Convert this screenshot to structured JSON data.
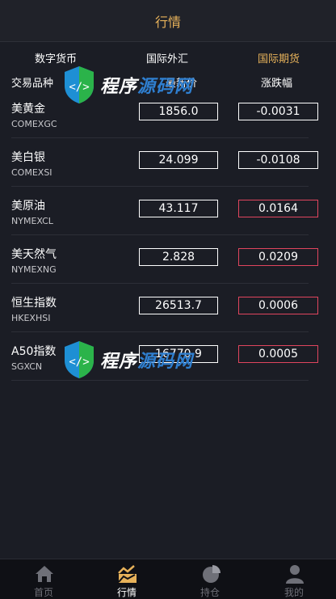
{
  "header": {
    "title": "行情"
  },
  "tabs": [
    {
      "label": "数字货币",
      "active": false
    },
    {
      "label": "国际外汇",
      "active": false
    },
    {
      "label": "国际期货",
      "active": true
    }
  ],
  "columns": {
    "name": "交易品种",
    "price": "最新价",
    "change": "涨跌幅"
  },
  "rows": [
    {
      "name": "美黄金",
      "code": "COMEXGC",
      "price": "1856.0",
      "change": "-0.0031",
      "direction": "down"
    },
    {
      "name": "美白银",
      "code": "COMEXSI",
      "price": "24.099",
      "change": "-0.0108",
      "direction": "down"
    },
    {
      "name": "美原油",
      "code": "NYMEXCL",
      "price": "43.117",
      "change": "0.0164",
      "direction": "up"
    },
    {
      "name": "美天然气",
      "code": "NYMEXNG",
      "price": "2.828",
      "change": "0.0209",
      "direction": "up"
    },
    {
      "name": "恒生指数",
      "code": "HKEXHSI",
      "price": "26513.7",
      "change": "0.0006",
      "direction": "up"
    },
    {
      "name": "A50指数",
      "code": "SGXCN",
      "price": "16770.9",
      "change": "0.0005",
      "direction": "up"
    }
  ],
  "watermark": {
    "text_white": "程序",
    "text_blue": "源码网"
  },
  "tabbar": [
    {
      "label": "首页",
      "icon": "home-icon",
      "active": false
    },
    {
      "label": "行情",
      "icon": "chart-icon",
      "active": true
    },
    {
      "label": "持仓",
      "icon": "pie-icon",
      "active": false
    },
    {
      "label": "我的",
      "icon": "user-icon",
      "active": false
    }
  ],
  "colors": {
    "accent": "#e7b25a",
    "up": "#e0455e",
    "background": "#1b1d25"
  }
}
